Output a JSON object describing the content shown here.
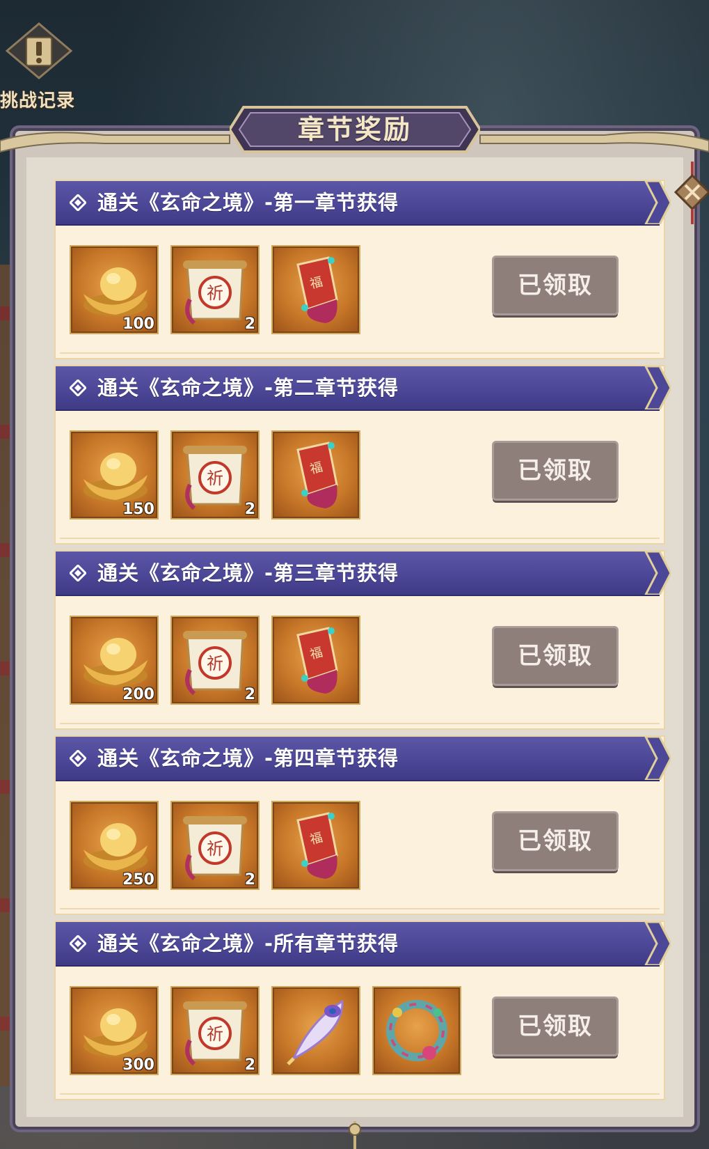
{
  "sidebar": {
    "record_label": "挑战记录",
    "record_icon": "book-exclamation-icon"
  },
  "panel": {
    "title": "章节奖励",
    "close_icon": "close-icon"
  },
  "colors": {
    "header_purple": "#4c4796",
    "card_bg": "#fbf1dd",
    "claimed_button": "#8f7f7b",
    "item_bg": "#c77728"
  },
  "rewards": [
    {
      "title": "通关《玄命之境》-第一章节获得",
      "items": [
        {
          "icon": "gold-ingot-icon",
          "count": "100"
        },
        {
          "icon": "prayer-scroll-icon",
          "count": "2"
        },
        {
          "icon": "fortune-charm-icon",
          "count": ""
        }
      ],
      "button": "已领取"
    },
    {
      "title": "通关《玄命之境》-第二章节获得",
      "items": [
        {
          "icon": "gold-ingot-icon",
          "count": "150"
        },
        {
          "icon": "prayer-scroll-icon",
          "count": "2"
        },
        {
          "icon": "fortune-charm-icon",
          "count": ""
        }
      ],
      "button": "已领取"
    },
    {
      "title": "通关《玄命之境》-第三章节获得",
      "items": [
        {
          "icon": "gold-ingot-icon",
          "count": "200"
        },
        {
          "icon": "prayer-scroll-icon",
          "count": "2"
        },
        {
          "icon": "fortune-charm-icon",
          "count": ""
        }
      ],
      "button": "已领取"
    },
    {
      "title": "通关《玄命之境》-第四章节获得",
      "items": [
        {
          "icon": "gold-ingot-icon",
          "count": "250"
        },
        {
          "icon": "prayer-scroll-icon",
          "count": "2"
        },
        {
          "icon": "fortune-charm-icon",
          "count": ""
        }
      ],
      "button": "已领取"
    },
    {
      "title": "通关《玄命之境》-所有章节获得",
      "items": [
        {
          "icon": "gold-ingot-icon",
          "count": "300"
        },
        {
          "icon": "prayer-scroll-icon",
          "count": "2"
        },
        {
          "icon": "peacock-feather-icon",
          "count": ""
        },
        {
          "icon": "flower-wreath-icon",
          "count": ""
        }
      ],
      "button": "已领取"
    }
  ]
}
